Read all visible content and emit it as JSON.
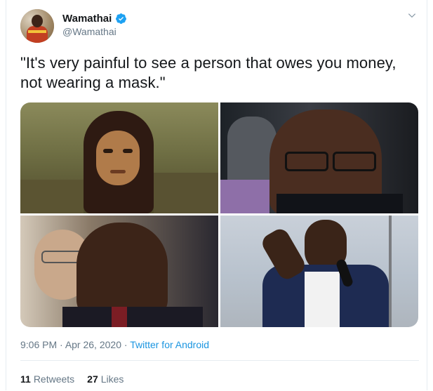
{
  "author": {
    "display_name": "Wamathai",
    "handle": "@Wamathai",
    "verified_icon": "verified-badge-icon",
    "menu_icon": "chevron-down-icon"
  },
  "tweet": {
    "text": "\"It's very painful to see a person that owes you money,\nnot wearing a mask.\""
  },
  "media": {
    "photo_count": 4
  },
  "meta": {
    "time": "9:06 PM",
    "separator1": " · ",
    "date": "Apr 26, 2020",
    "separator2": " · ",
    "source": "Twitter for Android"
  },
  "stats": {
    "retweets_count": "11",
    "retweets_label": "Retweets",
    "likes_count": "27",
    "likes_label": "Likes"
  },
  "colors": {
    "link": "#1b95e0",
    "secondary_text": "#657786",
    "primary_text": "#14171a"
  }
}
